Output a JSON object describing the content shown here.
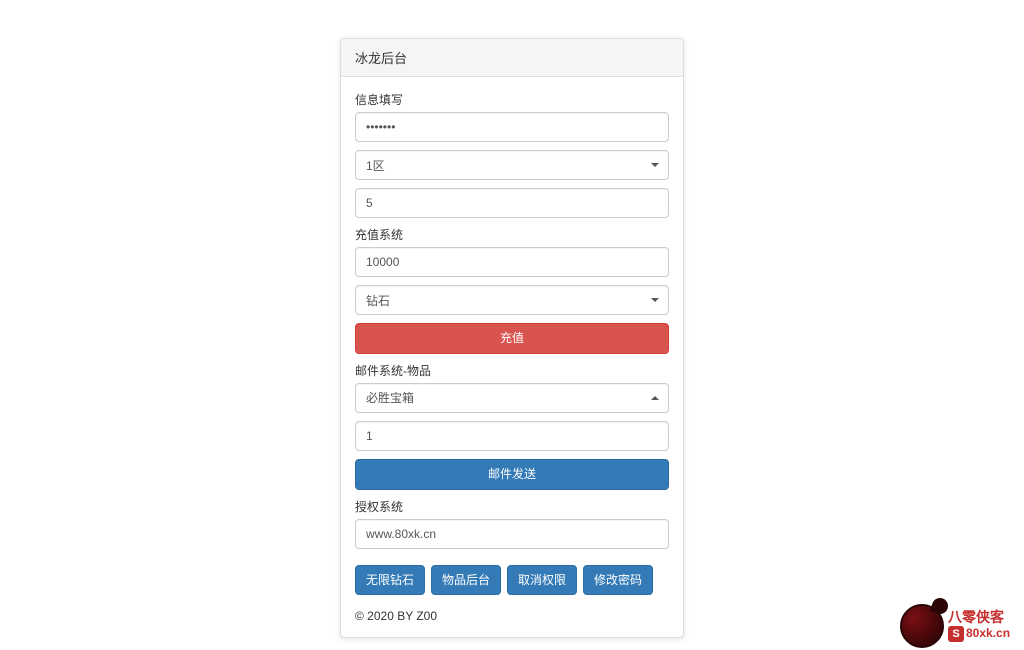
{
  "panel": {
    "title": "冰龙后台"
  },
  "section_info": {
    "label": "信息填写",
    "password_value": "•••••••",
    "region_select": "1区",
    "count_value": "5"
  },
  "section_recharge": {
    "label": "充值系统",
    "amount_value": "10000",
    "currency_select": "钻石",
    "submit_label": "充值"
  },
  "section_mail": {
    "label": "邮件系统-物品",
    "item_select": "必胜宝箱",
    "qty_value": "1",
    "submit_label": "邮件发送"
  },
  "section_auth": {
    "label": "授权系统",
    "domain_value": "www.80xk.cn"
  },
  "action_buttons": {
    "unlimited_diamond": "无限钻石",
    "item_admin": "物品后台",
    "revoke_perm": "取消权限",
    "change_pwd": "修改密码"
  },
  "footer": "© 2020 BY Z00",
  "watermark": {
    "title": "八零侠客",
    "badge_letter": "S",
    "url": "80xk.cn"
  }
}
